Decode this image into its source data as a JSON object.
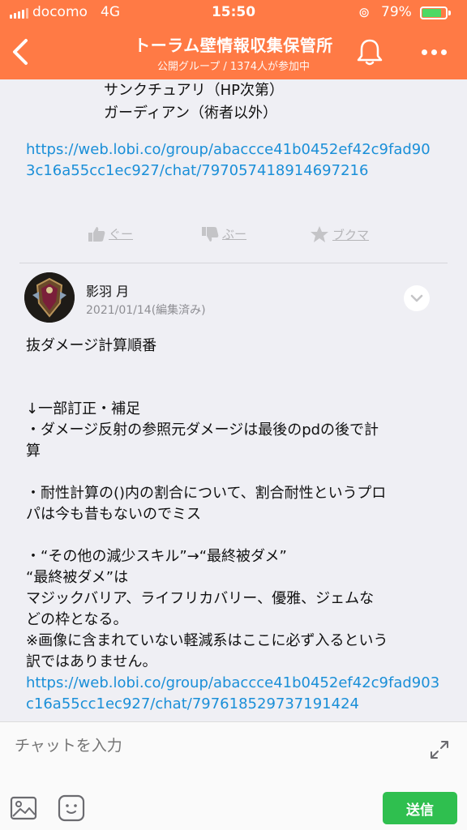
{
  "status_bar": {
    "carrier": "docomo",
    "network": "4G",
    "time": "15:50",
    "battery": "79%",
    "battery_level": 0.79
  },
  "header": {
    "title": "トーラム壁情報収集保管所",
    "subtitle": "公開グループ / 1374人が参加中"
  },
  "previous_post": {
    "lines": [
      "サンクチュアリ（HP次第）",
      "ガーディアン（術者以外）"
    ],
    "link": "https://web.lobi.co/group/abaccce41b0452ef42c9fad903c16a55cc1ec927/chat/797057418914697216",
    "reactions": {
      "good": "ぐー",
      "boo": "ぶー",
      "bookmark": "ブクマ"
    }
  },
  "post": {
    "author": "影羽 月",
    "date": "2021/01/14(編集済み)",
    "lines": [
      "抜ダメージ計算順番",
      "",
      "",
      "↓一部訂正・補足",
      "・ダメージ反射の参照元ダメージは最後のpdの後で計",
      "算",
      "",
      "・耐性計算の()内の割合について、割合耐性というプロ",
      "パは今も昔もないのでミス",
      "",
      "・“その他の減少スキル”→“最終被ダメ”",
      "“最終被ダメ”は",
      "マジックバリア、ライフリカバリー、優雅、ジェムな",
      "どの枠となる。",
      "※画像に含まれていない軽減系はここに必ず入るという",
      "訳ではありません。"
    ],
    "link": "https://web.lobi.co/group/abaccce41b0452ef42c9fad903c16a55cc1ec927/chat/797618529737191424"
  },
  "composer": {
    "placeholder": "チャットを入力",
    "send_label": "送信"
  },
  "colors": {
    "header": "#ff7a45",
    "link": "#1a8fd8",
    "send": "#2fbf4f"
  }
}
